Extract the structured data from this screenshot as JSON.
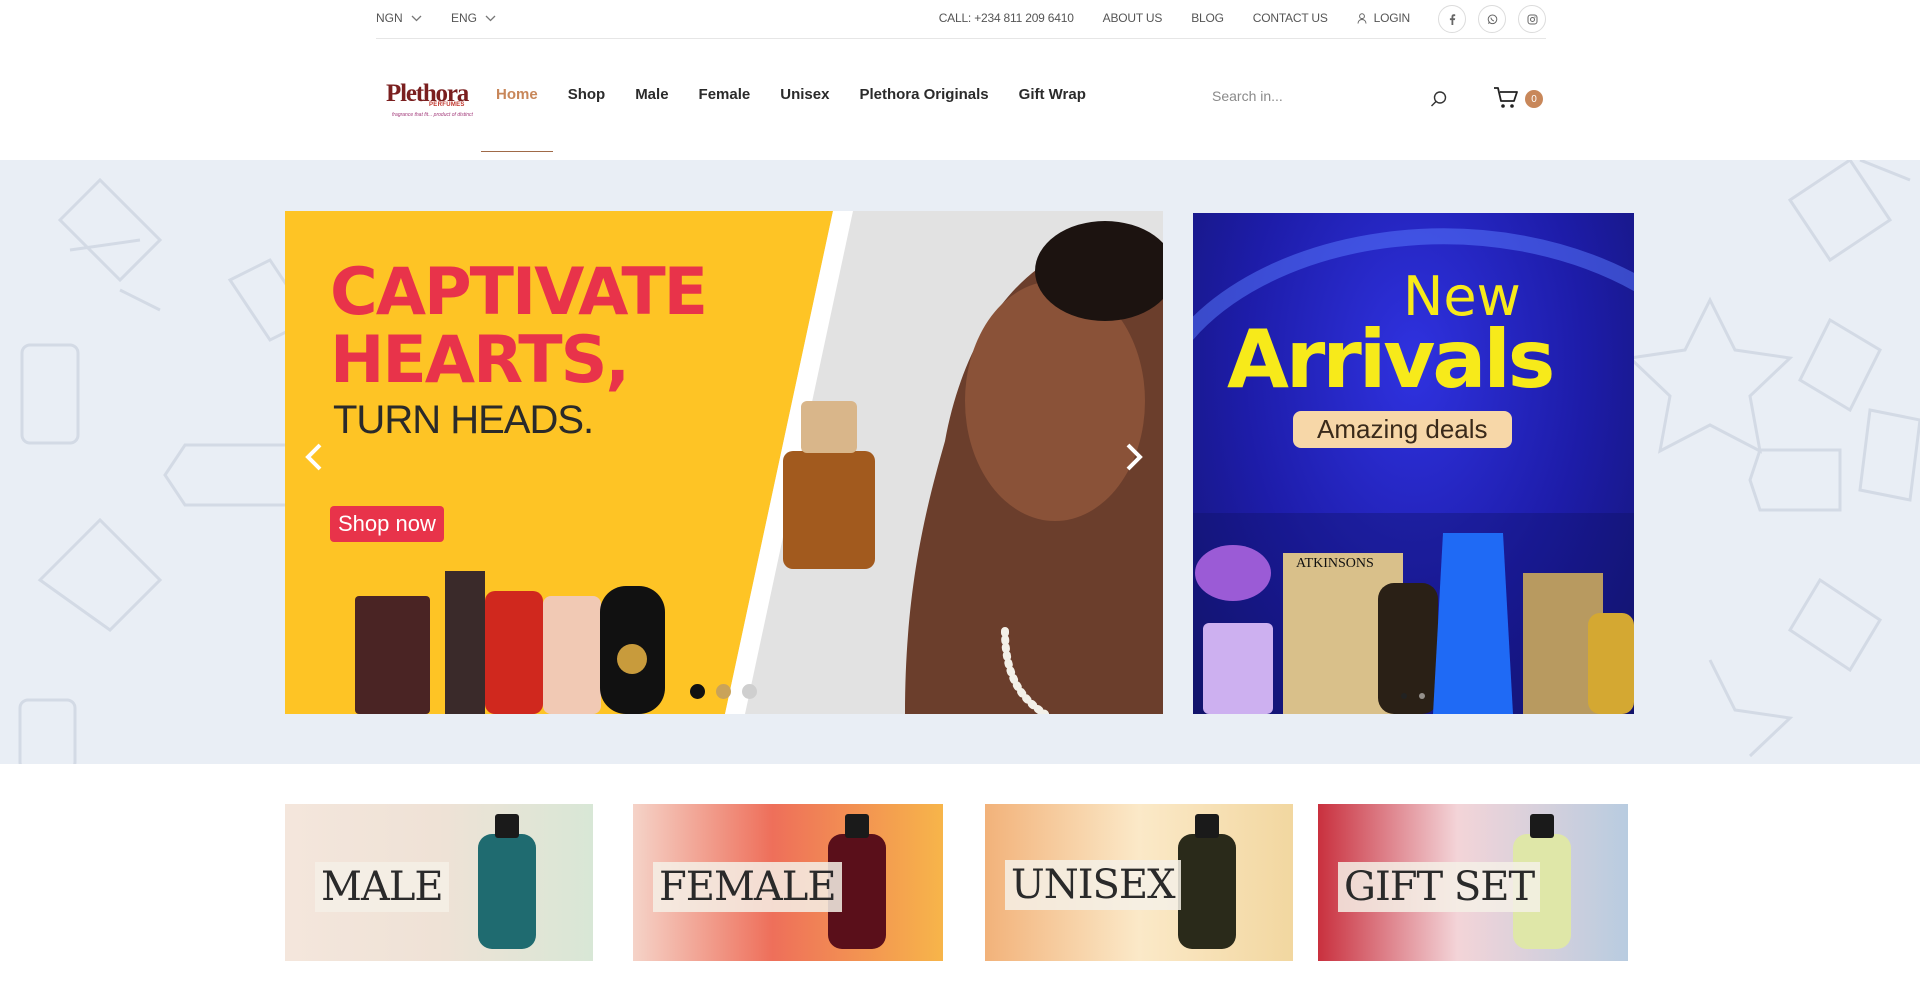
{
  "topbar": {
    "currency": "NGN",
    "language": "ENG",
    "call": "CALL: +234 811 209 6410",
    "about": "ABOUT US",
    "blog": "BLOG",
    "contact": "CONTACT US",
    "login": "LOGIN",
    "socials": [
      "facebook-icon",
      "whatsapp-icon",
      "instagram-icon"
    ]
  },
  "header": {
    "logo_text": "Plethora",
    "logo_subtext": "PERFUMES",
    "logo_tagline": "fragrance that fit... product of distinct",
    "nav": [
      "Home",
      "Shop",
      "Male",
      "Female",
      "Unisex",
      "Plethora Originals",
      "Gift Wrap"
    ],
    "active_nav": "Home",
    "search_placeholder": "Search in...",
    "cart_count": "0"
  },
  "hero": {
    "headline": "CAPTIVATE HEARTS,",
    "subline": "TURN HEADS.",
    "cta": "Shop now",
    "slide_count": 3,
    "active_slide": 1
  },
  "side_banner": {
    "line1": "New",
    "line2": "Arrivals",
    "line3": "Amazing deals",
    "brand": "ATKINSONS"
  },
  "categories": [
    "MALE",
    "FEMALE",
    "UNISEX",
    "GIFT SET"
  ],
  "colors": {
    "accent": "#c8875a",
    "hero_bg": "#e9eef5",
    "slide_yellow": "#fec425",
    "headline_red": "#e8334a",
    "banner_blue": "#2327c8",
    "arrivals_yellow": "#f7ea1a"
  }
}
